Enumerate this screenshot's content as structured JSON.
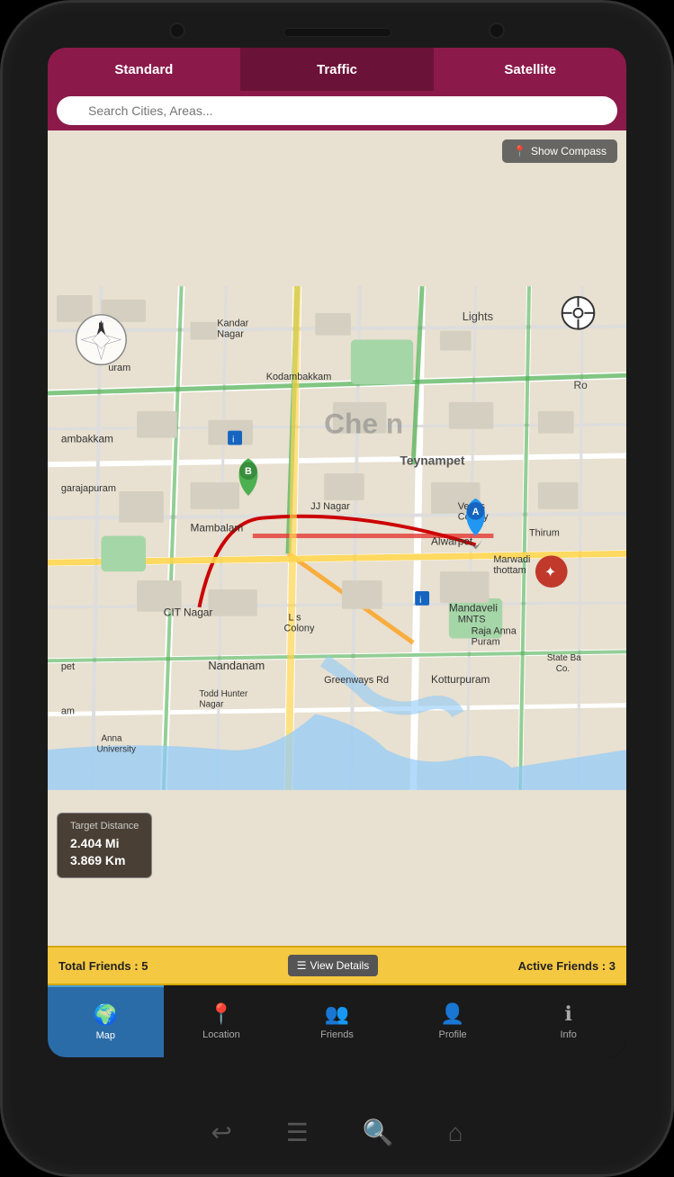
{
  "phone": {
    "speaker_label": "speaker"
  },
  "tabs": {
    "items": [
      {
        "label": "Standard",
        "active": false
      },
      {
        "label": "Traffic",
        "active": true
      },
      {
        "label": "Satellite",
        "active": false
      }
    ]
  },
  "search": {
    "placeholder": "Search Cities, Areas..."
  },
  "map": {
    "compass_btn": "Show Compass",
    "distance": {
      "title": "Target Distance",
      "mi": "2.404 Mi",
      "km": "3.869 Km"
    }
  },
  "friends_bar": {
    "total": "Total Friends : 5",
    "view_btn": "View Details",
    "active": "Active Friends : 3"
  },
  "bottom_nav": {
    "items": [
      {
        "label": "Map",
        "icon": "🌍",
        "active": true
      },
      {
        "label": "Location",
        "icon": "📍",
        "active": false
      },
      {
        "label": "Friends",
        "icon": "👥",
        "active": false
      },
      {
        "label": "Profile",
        "icon": "👤",
        "active": false
      },
      {
        "label": "Info",
        "icon": "ℹ",
        "active": false
      }
    ]
  },
  "nav_buttons": {
    "back": "↩",
    "menu": "☰",
    "search": "🔍",
    "home": "⌂"
  }
}
